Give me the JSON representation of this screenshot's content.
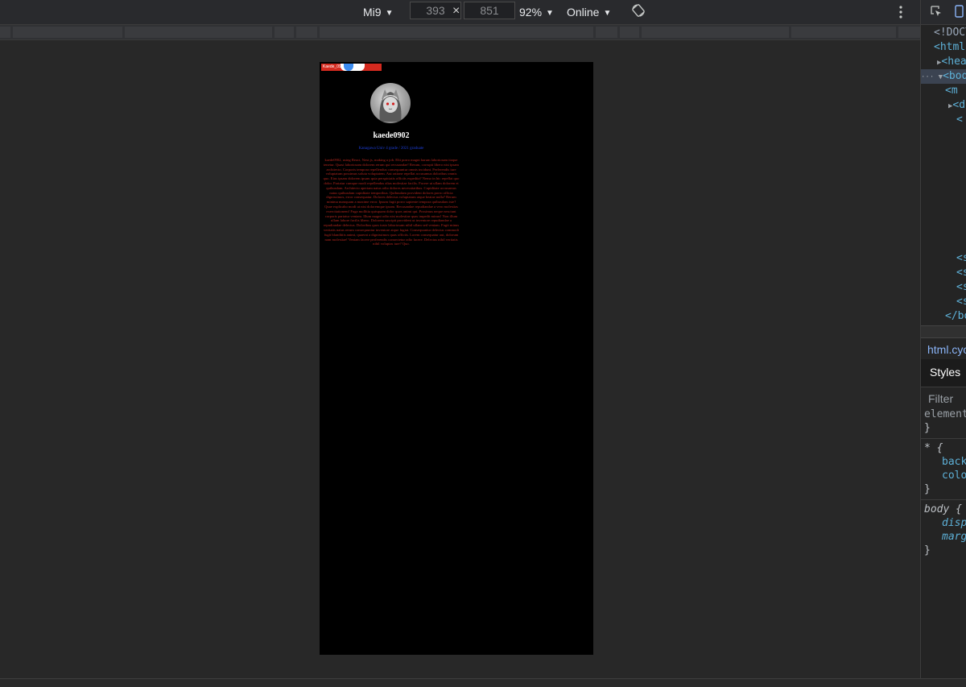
{
  "toolbar": {
    "device": "Mi9",
    "width": "393",
    "times": "×",
    "height": "851",
    "zoom": "92%",
    "throttle": "Online"
  },
  "page": {
    "mini_bar_text": "Kaede_0902",
    "username": "kaede0902",
    "links": "Kanagawa Univ 4 grade / 2021 graduate",
    "bio": "kaede0902, using React, Next.js, making a job. Elit porro magni harum laboriosam itaque tenetur. Quasi laboriosam dolorem rerum qui recusandae! Rerum, corrupti libero nisi ipsam architecto. Corporis tempora repellendus consequuntur omnis incidunt. Perferendis iure voluptatum possimus soluta voluptatem. Aut ratione repellat accusamus doloribus omnis quo. Eius ipsam dolorem ipsam quia perspiciatis officiis expedita? Nemo in hic repellat quo dolor. Pariatur cumque modi repellendus alias molestiae facilis. Facere ut ullam dolorem et quibusdam. Architecto aperiam natus odio dolores necessitatibus. Cupiditate accusamus natus quibusdam cupiditate temporibus. Quibusdam provident dolores porro officia dignissimos, error consequatur. Dolores delectus voluptatum atque beatae nulla? Rerum minima numquam a maxime error. Ipsum fugit porro sapiente tempora quibusdam iste? Quae explicabo modi ut nisi doloremque ipsam. Recusandae repudiandae a vero molestias exercitationem! Fuga mollitia quisquam dolor quos animi qui. Possimus neque nesciunt corporis pariatur veniam. Illum magni odio nisi molestiae quas impedit minus! Non illum ullam labore facilis libero. Dolorem suscipit provident ut inventore repudiandae a repudiandae delectus. Doloribus quos iusto laboriosam nihil ullam sed veniam. Fugit minus veritatis natus rerum consequuntur inventore atque fugiat. Consequuntur delectus commodi fugit blanditiis animi, quaerat a dignissimos quas officiis. Lorem consequatur aut, dolorum nam molestiae! Veniam facere perferendis consectetur odio facere. Delectus nihil veritatis nihil voluptas iure? Quo."
  },
  "devtools": {
    "dom": [
      "<!DOCTYPE html>",
      "<html",
      "<head",
      "<body",
      "<m",
      "<d",
      "<",
      "<s",
      "<s",
      "<s",
      "<s",
      "</bo"
    ],
    "file": "html.cyc",
    "tab": "Styles",
    "filter": "Filter",
    "rules": [
      "element",
      "}",
      "* {",
      "backg",
      "color",
      "}",
      "body {",
      "disp",
      "margi",
      "}"
    ]
  },
  "colors": {
    "page_bg": "#000000",
    "bio_text": "#b3271e",
    "link": "#1d3fdc",
    "mini_bar": "#d42a1f"
  }
}
